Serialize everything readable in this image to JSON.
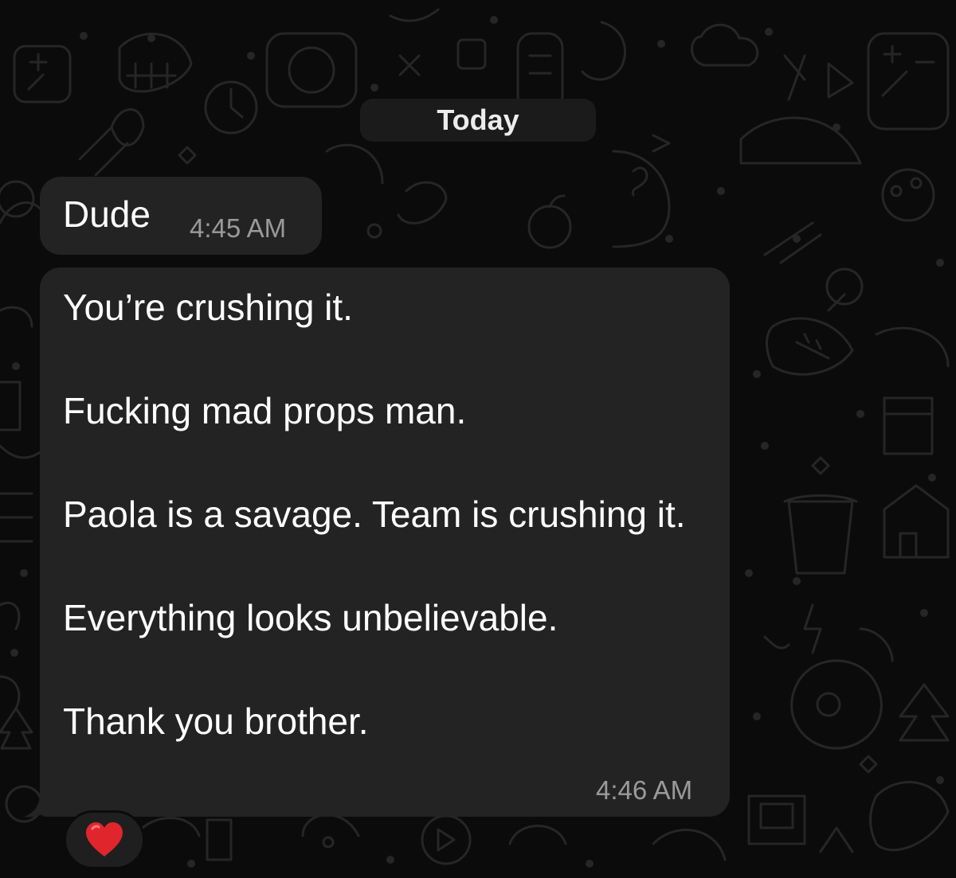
{
  "chat": {
    "date_separator": "Today",
    "messages": [
      {
        "text": "Dude",
        "time": "4:45 AM"
      },
      {
        "paragraphs": [
          "You’re crushing it.",
          "Fucking mad props man.",
          "Paola is a savage. Team is crushing it.",
          "Everything looks unbelievable.",
          "Thank you brother."
        ],
        "time": "4:46 AM",
        "reaction_icon": "red-heart-icon"
      }
    ]
  },
  "colors": {
    "background": "#0b0b0b",
    "bubble": "#232323",
    "date_pill": "#1b1b1b",
    "timestamp": "#9a9a9a",
    "heart": "#e0262c"
  }
}
